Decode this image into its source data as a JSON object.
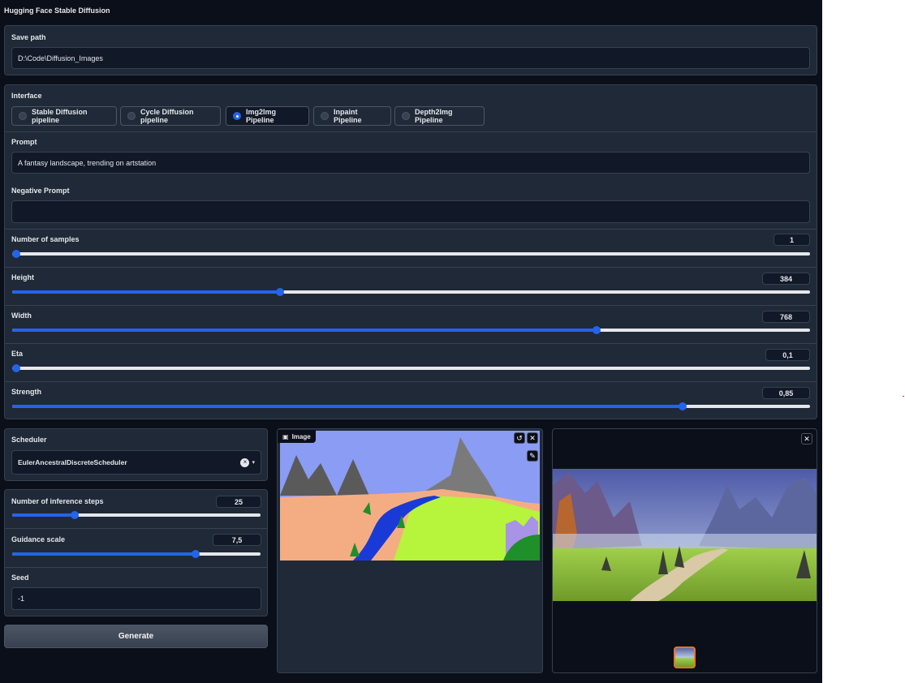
{
  "app": {
    "title": "Hugging Face Stable Diffusion"
  },
  "save_path": {
    "label": "Save path",
    "value": "D:\\Code\\Diffusion_Images"
  },
  "interface": {
    "label": "Interface",
    "options": [
      "Stable Diffusion pipeline",
      "Cycle Diffusion pipeline",
      "Img2Img Pipeline",
      "Inpaint Pipeline",
      "Depth2Img Pipeline"
    ],
    "selected": "Img2Img Pipeline"
  },
  "prompt": {
    "label": "Prompt",
    "value": "A fantasy landscape, trending on artstation"
  },
  "negative_prompt": {
    "label": "Negative Prompt",
    "value": ""
  },
  "sliders": {
    "samples": {
      "label": "Number of samples",
      "value": "1",
      "fraction": 0.0
    },
    "height": {
      "label": "Height",
      "value": "384",
      "fraction": 0.336
    },
    "width": {
      "label": "Width",
      "value": "768",
      "fraction": 0.732
    },
    "eta": {
      "label": "Eta",
      "value": "0,1",
      "fraction": 0.0
    },
    "strength": {
      "label": "Strength",
      "value": "0,85",
      "fraction": 0.84
    },
    "steps": {
      "label": "Number of inference steps",
      "value": "25",
      "fraction": 0.25
    },
    "guidance": {
      "label": "Guidance scale",
      "value": "7,5",
      "fraction": 0.74
    }
  },
  "scheduler": {
    "label": "Scheduler",
    "value": "EulerAncestralDiscreteScheduler"
  },
  "seed": {
    "label": "Seed",
    "value": "-1"
  },
  "generate": {
    "label": "Generate"
  },
  "input_image": {
    "label": "Image"
  },
  "icons": {
    "clear": "x-icon",
    "undo": "undo-icon",
    "brush": "brush-icon",
    "image": "image-icon"
  },
  "colors": {
    "accent": "#2563eb",
    "background": "#0b0f19",
    "panel": "#1f2937"
  }
}
